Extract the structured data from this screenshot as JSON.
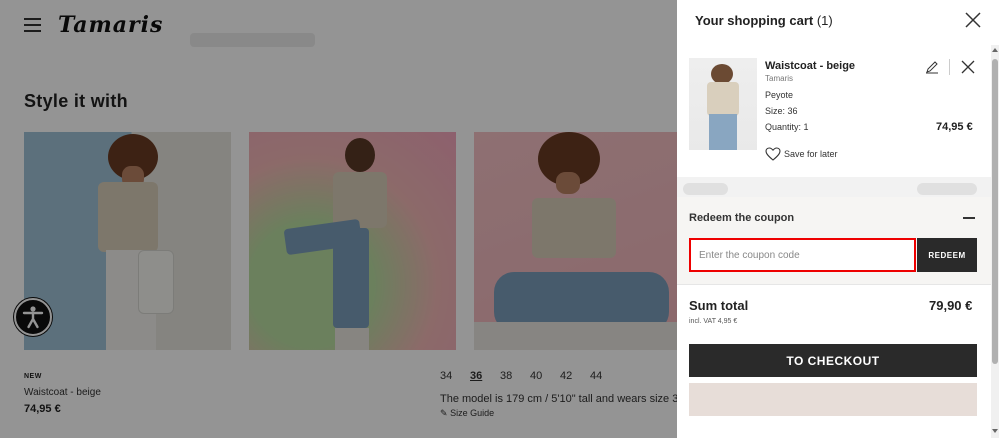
{
  "header": {
    "logo_text": "Tamaris"
  },
  "section": {
    "title": "Style it with"
  },
  "product": {
    "badge": "NEW",
    "name": "Waistcoat - beige",
    "price": "74,95 €",
    "sizes": [
      "34",
      "36",
      "38",
      "40",
      "42",
      "44"
    ],
    "selected_size": "36",
    "model_note": "The model is 179 cm / 5'10\" tall and wears size 3",
    "size_guide": "Size Guide"
  },
  "cart": {
    "title": "Your shopping cart",
    "count": "(1)",
    "item": {
      "name": "Waistcoat - beige",
      "brand": "Tamaris",
      "color": "Peyote",
      "size": "Size: 36",
      "quantity": "Quantity: 1",
      "price": "74,95 €",
      "save_later": "Save for later"
    },
    "coupon": {
      "title": "Redeem the coupon",
      "placeholder": "Enter the coupon code",
      "redeem_label": "REDEEM"
    },
    "sum_label": "Sum total",
    "sum_value": "79,90 €",
    "vat": "incl. VAT 4,95 €",
    "checkout_label": "TO CHECKOUT"
  },
  "colors": {
    "accent_dark": "#2a2a2a",
    "coupon_border": "#ee0000",
    "alt_button": "#e7ddd8"
  }
}
